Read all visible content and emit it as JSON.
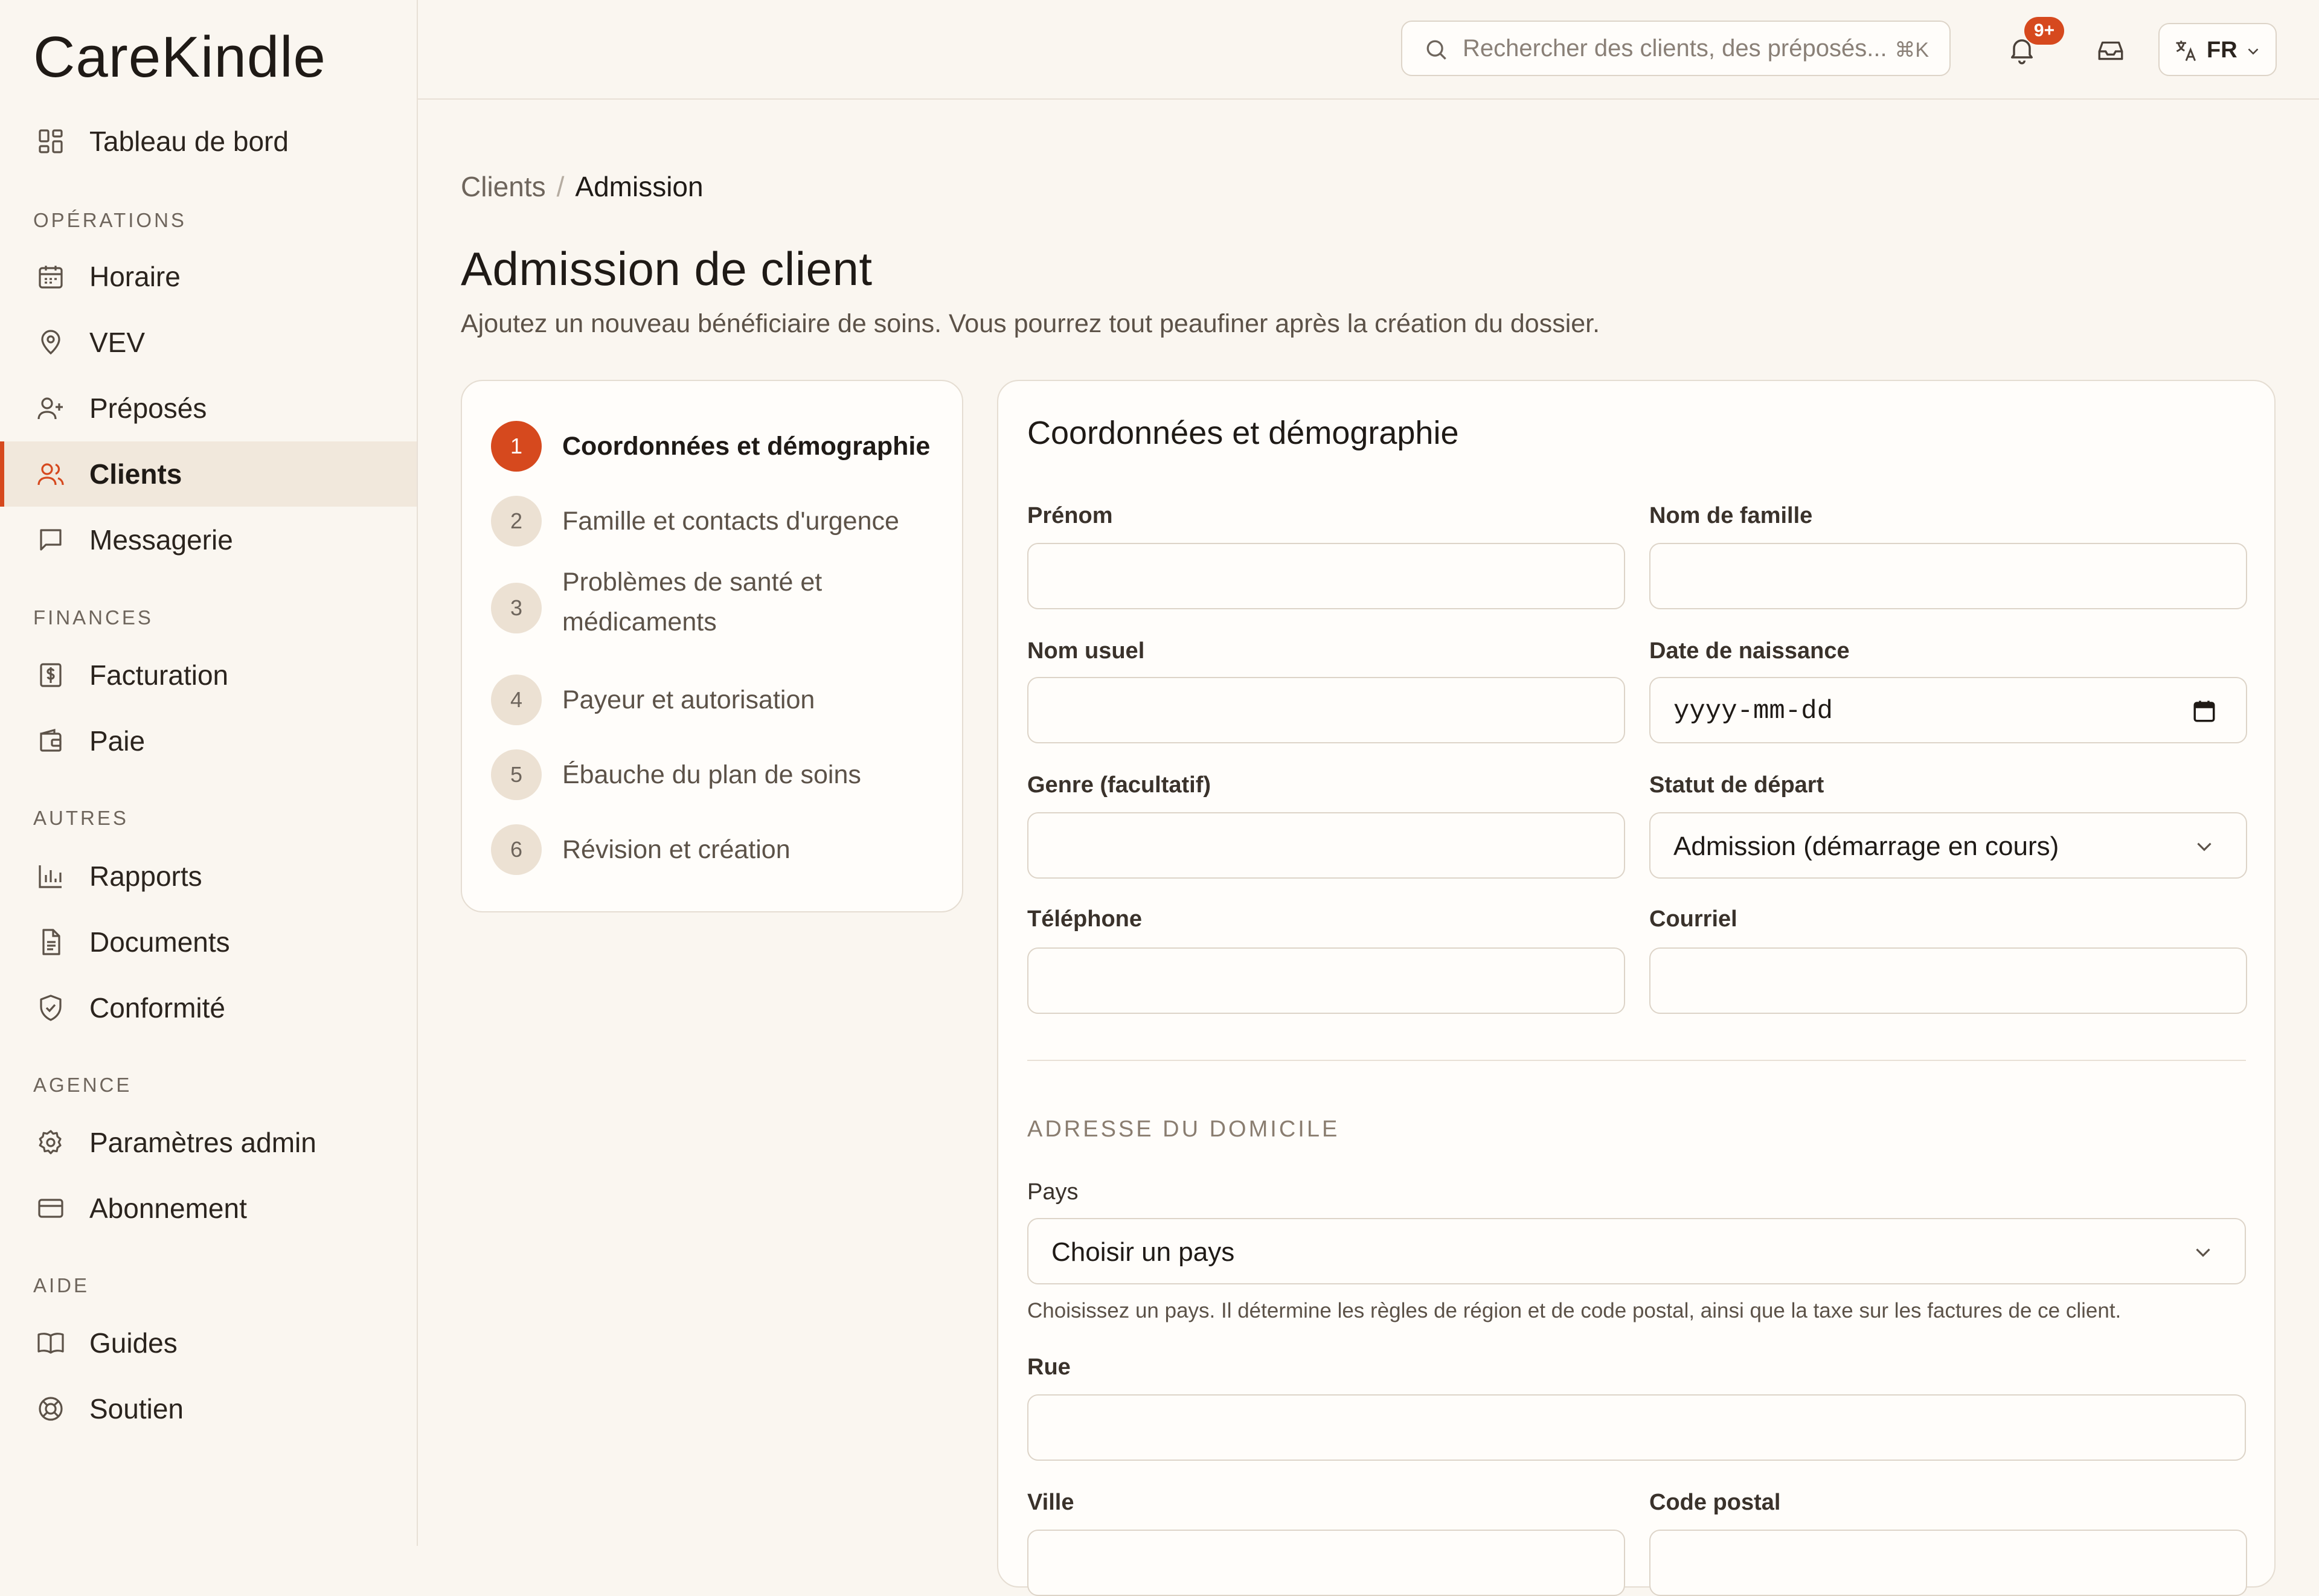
{
  "app": {
    "logo": "CareKindle",
    "brand_color": "#d6491e"
  },
  "sidebar": {
    "top_item": {
      "label": "Tableau de bord",
      "icon": "dashboard-icon"
    },
    "sections": [
      {
        "title": "OPÉRATIONS",
        "items": [
          {
            "label": "Horaire",
            "icon": "calendar-icon"
          },
          {
            "label": "VEV",
            "icon": "map-pin-icon"
          },
          {
            "label": "Préposés",
            "icon": "user-plus-icon"
          },
          {
            "label": "Clients",
            "icon": "users-icon",
            "active": true
          },
          {
            "label": "Messagerie",
            "icon": "message-icon"
          }
        ]
      },
      {
        "title": "FINANCES",
        "items": [
          {
            "label": "Facturation",
            "icon": "invoice-dollar-icon"
          },
          {
            "label": "Paie",
            "icon": "wallet-icon"
          }
        ]
      },
      {
        "title": "AUTRES",
        "items": [
          {
            "label": "Rapports",
            "icon": "bar-chart-icon"
          },
          {
            "label": "Documents",
            "icon": "document-icon"
          },
          {
            "label": "Conformité",
            "icon": "shield-check-icon"
          }
        ]
      },
      {
        "title": "AGENCE",
        "items": [
          {
            "label": "Paramètres admin",
            "icon": "gear-icon"
          },
          {
            "label": "Abonnement",
            "icon": "credit-card-icon"
          }
        ]
      },
      {
        "title": "AIDE",
        "items": [
          {
            "label": "Guides",
            "icon": "book-icon"
          },
          {
            "label": "Soutien",
            "icon": "lifebuoy-icon"
          }
        ]
      }
    ]
  },
  "topbar": {
    "search_placeholder": "Rechercher des clients, des préposés...",
    "search_shortcut": "⌘K",
    "notification_badge": "9+",
    "language": "FR"
  },
  "breadcrumb": {
    "parent": "Clients",
    "separator": "/",
    "current": "Admission"
  },
  "page": {
    "title": "Admission de client",
    "subtitle": "Ajoutez un nouveau bénéficiaire de soins. Vous pourrez tout peaufiner après la création du dossier."
  },
  "steps": [
    {
      "num": "1",
      "label": "Coordonnées et démographie",
      "active": true
    },
    {
      "num": "2",
      "label": "Famille et contacts d'urgence"
    },
    {
      "num": "3",
      "label": "Problèmes de santé et médicaments"
    },
    {
      "num": "4",
      "label": "Payeur et autorisation"
    },
    {
      "num": "5",
      "label": "Ébauche du plan de soins"
    },
    {
      "num": "6",
      "label": "Révision et création"
    }
  ],
  "form": {
    "title": "Coordonnées et démographie",
    "first_name": {
      "label": "Prénom",
      "value": ""
    },
    "last_name": {
      "label": "Nom de famille",
      "value": ""
    },
    "preferred_name": {
      "label": "Nom usuel",
      "value": ""
    },
    "birth_date": {
      "label": "Date de naissance",
      "value": "yyyy-mm-dd"
    },
    "gender": {
      "label": "Genre (facultatif)",
      "value": ""
    },
    "start_status": {
      "label": "Statut de départ",
      "value": "Admission (démarrage en cours)"
    },
    "phone": {
      "label": "Téléphone",
      "value": ""
    },
    "email": {
      "label": "Courriel",
      "value": ""
    },
    "address_section": "ADRESSE DU DOMICILE",
    "country": {
      "label": "Pays",
      "value": "Choisir un pays",
      "hint": "Choisissez un pays. Il détermine les règles de région et de code postal, ainsi que la taxe sur les factures de ce client."
    },
    "street": {
      "label": "Rue",
      "value": ""
    },
    "city": {
      "label": "Ville",
      "value": ""
    },
    "postal_code": {
      "label": "Code postal",
      "value": ""
    }
  }
}
